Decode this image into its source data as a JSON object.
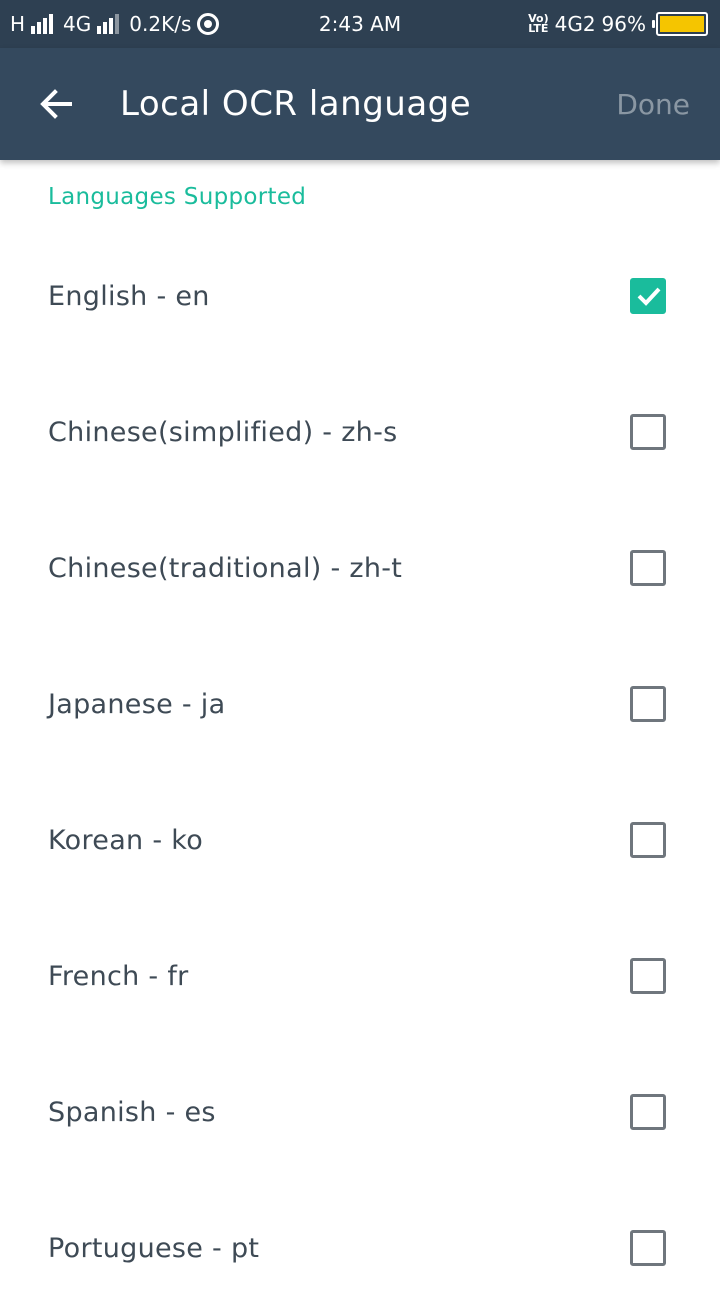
{
  "status_bar": {
    "network_h": "H",
    "network_4g": "4G",
    "speed": "0.2K/s",
    "time": "2:43 AM",
    "volte_top": "Vo)",
    "volte_bottom": "LTE",
    "network_4g2": "4G2",
    "battery": "96%",
    "battery_color": "#f5c500"
  },
  "app_bar": {
    "title": "Local OCR language",
    "done_label": "Done",
    "back_icon": "arrow-left-icon",
    "background": "#34495e"
  },
  "section": {
    "header": "Languages Supported",
    "accent_color": "#1abc9c"
  },
  "languages": [
    {
      "label": "English - en",
      "checked": true
    },
    {
      "label": "Chinese(simplified) - zh-s",
      "checked": false
    },
    {
      "label": "Chinese(traditional) - zh-t",
      "checked": false
    },
    {
      "label": "Japanese - ja",
      "checked": false
    },
    {
      "label": "Korean - ko",
      "checked": false
    },
    {
      "label": "French - fr",
      "checked": false
    },
    {
      "label": "Spanish - es",
      "checked": false
    },
    {
      "label": "Portuguese - pt",
      "checked": false
    }
  ]
}
